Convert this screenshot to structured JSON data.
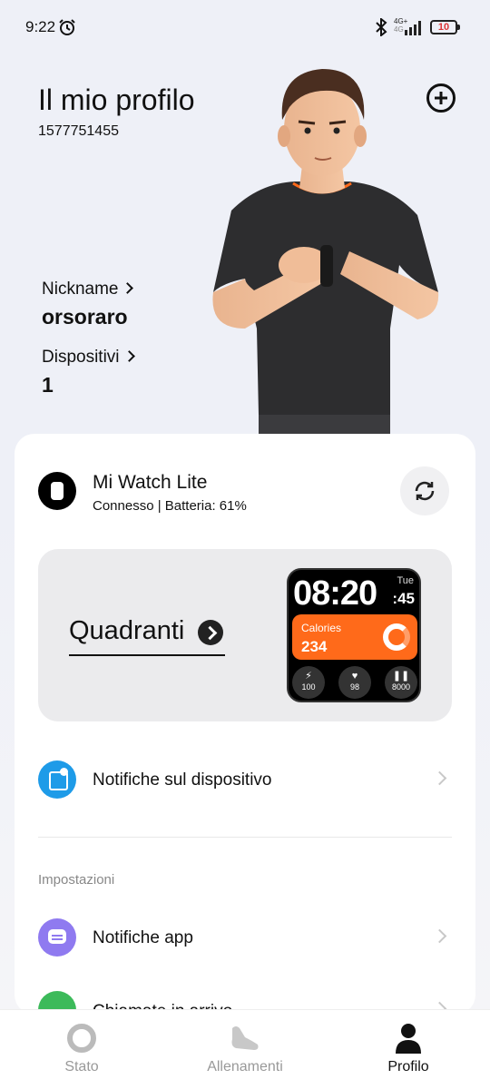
{
  "status_bar": {
    "time": "9:22",
    "network_label_top": "4G+",
    "network_label_bottom": "4G",
    "battery_level": "10"
  },
  "profile": {
    "title": "Il mio profilo",
    "user_id": "1577751455",
    "nickname_label": "Nickname",
    "nickname_value": "orsoraro",
    "devices_label": "Dispositivi",
    "devices_value": "1"
  },
  "device": {
    "name": "Mi Watch Lite",
    "status": "Connesso | Batteria: 61%"
  },
  "watch_faces": {
    "label": "Quadranti",
    "preview": {
      "time": "08:20",
      "seconds": "45",
      "day": "Tue",
      "calories_label": "Calories",
      "calories_value": "234",
      "stats": [
        "100",
        "98",
        "8000"
      ],
      "accent_color": "#ff6a1a"
    }
  },
  "menu": {
    "device_notifications": "Notifiche sul dispositivo",
    "settings_header": "Impostazioni",
    "app_notifications": "Notifiche app",
    "partial_item": "Chiamate in arrivo"
  },
  "bottom_nav": {
    "items": [
      {
        "label": "Stato",
        "icon": "ring-icon"
      },
      {
        "label": "Allenamenti",
        "icon": "shoe-icon"
      },
      {
        "label": "Profilo",
        "icon": "person-icon",
        "active": true
      }
    ]
  }
}
